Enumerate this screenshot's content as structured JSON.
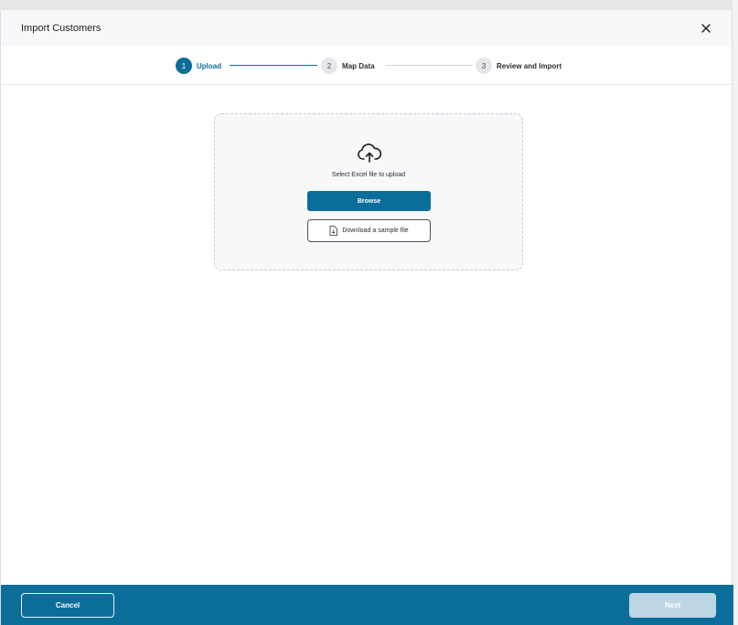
{
  "dialog": {
    "title": "Import Customers",
    "close_icon": "close-icon"
  },
  "stepper": {
    "steps": [
      {
        "number": "1",
        "label": "Upload",
        "state": "active"
      },
      {
        "number": "2",
        "label": "Map Data",
        "state": "inactive"
      },
      {
        "number": "3",
        "label": "Review and Import",
        "state": "inactive"
      }
    ]
  },
  "upload": {
    "icon": "cloud-upload-icon",
    "prompt": "Select Excel file to upload",
    "browse_label": "Browse",
    "sample_label": "Download a sample file",
    "sample_icon": "file-download-icon"
  },
  "footer": {
    "cancel_label": "Cancel",
    "next_label": "Next"
  },
  "colors": {
    "accent": "#0b6e9a",
    "next_disabled": "#bcd6e4"
  }
}
